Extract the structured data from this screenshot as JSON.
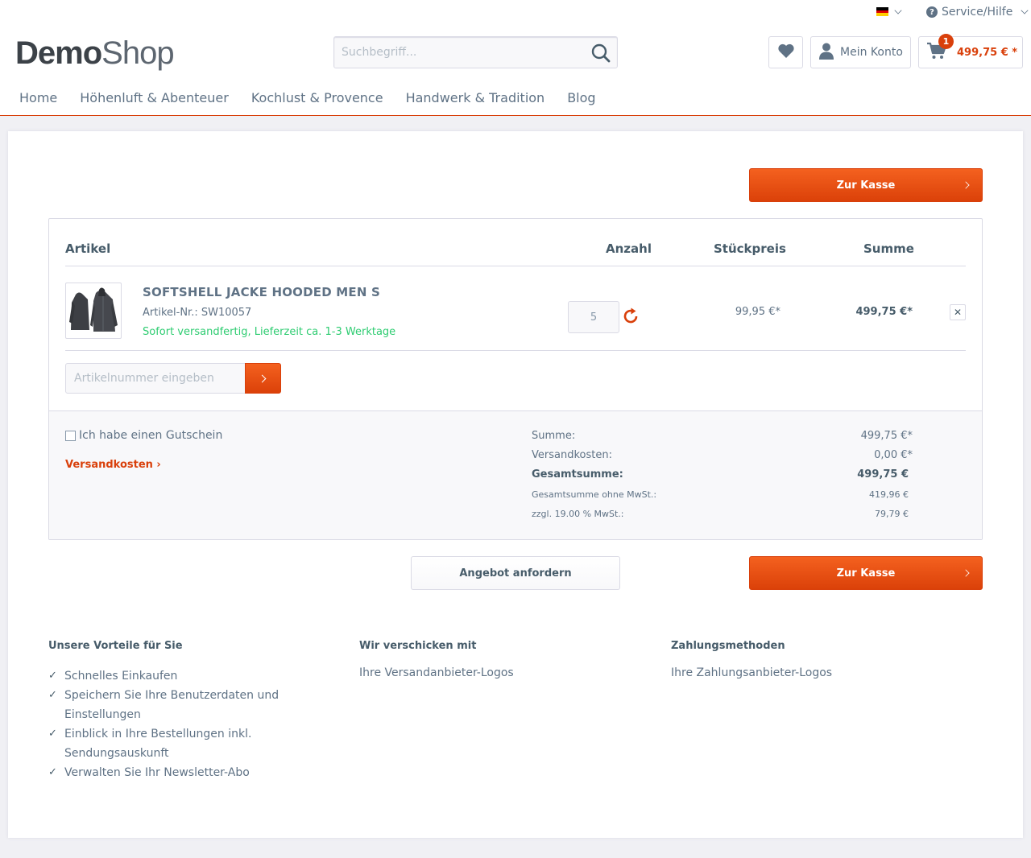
{
  "topbar": {
    "language_flag": "de",
    "service_label": "Service/Hilfe"
  },
  "logo": {
    "part1": "Demo",
    "part2": "Shop"
  },
  "search": {
    "placeholder": "Suchbegriff..."
  },
  "header": {
    "account_label": "Mein Konto",
    "cart_count": "1",
    "cart_amount": "499,75 € *"
  },
  "nav": {
    "items": [
      "Home",
      "Höhenluft & Abenteuer",
      "Kochlust & Provence",
      "Handwerk & Tradition",
      "Blog"
    ]
  },
  "checkout_label": "Zur Kasse",
  "basket": {
    "headers": {
      "article": "Artikel",
      "quantity": "Anzahl",
      "unit_price": "Stückpreis",
      "total": "Summe"
    },
    "item": {
      "name": "SOFTSHELL JACKE HOODED MEN S",
      "sku": "Artikel-Nr.: SW10057",
      "delivery": "Sofort versandfertig, Lieferzeit ca. 1-3 Werktage",
      "quantity": "5",
      "unit_price": "99,95 €*",
      "total": "499,75 €*",
      "remove_label": "✕"
    },
    "add_article_placeholder": "Artikelnummer eingeben"
  },
  "summary": {
    "voucher_label": "Ich habe einen Gutschein",
    "shipping_link": "Versandkosten",
    "rows": [
      {
        "label": "Summe:",
        "value": "499,75 €*"
      },
      {
        "label": "Versandkosten:",
        "value": "0,00 €*"
      },
      {
        "label": "Gesamtsumme:",
        "value": "499,75 €"
      },
      {
        "label": "Gesamtsumme ohne MwSt.:",
        "value": "419,96 €"
      },
      {
        "label": "zzgl. 19.00 % MwSt.:",
        "value": "79,79 €"
      }
    ]
  },
  "offer_button": "Angebot anfordern",
  "footer": {
    "benefits_title": "Unsere Vorteile für Sie",
    "benefits": [
      "Schnelles Einkaufen",
      "Speichern Sie Ihre Benutzerdaten und Einstellungen",
      "Einblick in Ihre Bestellungen inkl. Sendungsauskunft",
      "Verwalten Sie Ihr Newsletter-Abo"
    ],
    "shipping_title": "Wir verschicken mit",
    "shipping_text": "Ihre Versandanbieter-Logos",
    "payment_title": "Zahlungsmethoden",
    "payment_text": "Ihre Zahlungsanbieter-Logos"
  },
  "colors": {
    "accent": "#d9400b",
    "text": "#5f7285",
    "success": "#2ecc71"
  }
}
